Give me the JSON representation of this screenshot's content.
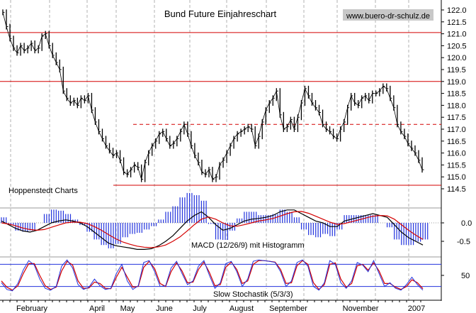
{
  "chart_data": {
    "type": "line",
    "title": "Bund Future Einjahreschart",
    "watermark": "www.buero-dr-schulz.de",
    "source_label": "Hoppenstedt Charts",
    "x_tick_labels": [
      "February",
      "April",
      "May",
      "June",
      "July",
      "August",
      "September",
      "November",
      "2007"
    ],
    "price_panel": {
      "y_tick_labels": [
        "122.0",
        "121.5",
        "121.0",
        "120.5",
        "120.0",
        "119.5",
        "119.0",
        "118.5",
        "118.0",
        "117.5",
        "117.0",
        "116.5",
        "116.0",
        "115.5",
        "115.0",
        "114.5"
      ],
      "ylim": [
        114.3,
        122.2
      ],
      "horizontal_lines": [
        {
          "value": 121.05,
          "style": "solid",
          "color": "#d40000"
        },
        {
          "value": 119.0,
          "style": "solid",
          "color": "#d40000"
        },
        {
          "value": 117.2,
          "style": "dashed",
          "color": "#d40000"
        },
        {
          "value": 114.65,
          "style": "solid",
          "color": "#d40000"
        }
      ],
      "series_close": [
        121.9,
        121.3,
        120.8,
        120.4,
        120.2,
        120.5,
        120.3,
        120.4,
        120.6,
        120.3,
        120.4,
        120.9,
        121.0,
        120.5,
        120.1,
        119.8,
        119.5,
        118.6,
        118.3,
        118.1,
        118.2,
        118.0,
        118.3,
        118.2,
        118.4,
        117.8,
        117.3,
        116.9,
        116.6,
        116.3,
        116.1,
        115.9,
        116.0,
        115.7,
        115.2,
        115.1,
        115.3,
        115.5,
        115.4,
        114.9,
        115.6,
        116.0,
        116.3,
        116.5,
        116.8,
        116.9,
        116.6,
        116.3,
        116.4,
        116.6,
        116.9,
        117.2,
        116.8,
        116.3,
        115.9,
        115.6,
        115.2,
        115.1,
        115.3,
        114.9,
        115.0,
        115.5,
        115.7,
        116.0,
        116.3,
        116.6,
        116.8,
        116.9,
        117.0,
        117.1,
        117.0,
        116.3,
        116.7,
        117.3,
        117.8,
        118.1,
        118.3,
        118.6,
        117.6,
        117.0,
        117.1,
        117.4,
        117.0,
        117.5,
        118.1,
        118.7,
        118.4,
        118.1,
        117.9,
        117.7,
        117.2,
        117.0,
        116.9,
        116.7,
        116.6,
        117.0,
        117.3,
        117.9,
        118.4,
        118.1,
        118.0,
        118.3,
        118.4,
        118.2,
        118.5,
        118.5,
        118.6,
        118.8,
        118.7,
        118.3,
        117.9,
        117.2,
        116.9,
        116.7,
        116.4,
        116.2,
        116.0,
        115.7,
        115.3
      ]
    },
    "macd_panel": {
      "label": "MACD (12/26/9) mit Histogramm",
      "y_tick_labels": [
        "0.0",
        "-0.5"
      ],
      "ylim": [
        -0.8,
        0.6
      ],
      "macd": [
        0.05,
        -0.05,
        -0.15,
        -0.22,
        -0.25,
        -0.2,
        -0.1,
        0.0,
        0.05,
        0.08,
        0.05,
        0.0,
        -0.1,
        -0.25,
        -0.4,
        -0.55,
        -0.62,
        -0.65,
        -0.68,
        -0.72,
        -0.72,
        -0.7,
        -0.62,
        -0.5,
        -0.35,
        -0.15,
        0.05,
        0.2,
        0.3,
        0.15,
        -0.05,
        -0.2,
        -0.15,
        -0.05,
        0.05,
        0.1,
        0.12,
        0.15,
        0.2,
        0.3,
        0.35,
        0.35,
        0.25,
        0.15,
        0.05,
        0.0,
        -0.1,
        -0.1,
        0.05,
        0.1,
        0.15,
        0.2,
        0.25,
        0.2,
        0.15,
        -0.05,
        -0.25,
        -0.4,
        -0.5,
        -0.6
      ],
      "signal": [
        0.0,
        -0.03,
        -0.08,
        -0.14,
        -0.18,
        -0.2,
        -0.18,
        -0.12,
        -0.06,
        0.0,
        0.02,
        0.02,
        -0.02,
        -0.1,
        -0.2,
        -0.32,
        -0.43,
        -0.52,
        -0.58,
        -0.63,
        -0.66,
        -0.67,
        -0.65,
        -0.6,
        -0.5,
        -0.38,
        -0.22,
        -0.05,
        0.1,
        0.16,
        0.1,
        0.0,
        -0.08,
        -0.09,
        -0.05,
        0.0,
        0.05,
        0.08,
        0.12,
        0.18,
        0.25,
        0.3,
        0.31,
        0.26,
        0.18,
        0.1,
        0.02,
        -0.04,
        -0.02,
        0.03,
        0.08,
        0.13,
        0.18,
        0.2,
        0.19,
        0.1,
        -0.05,
        -0.2,
        -0.33,
        -0.45
      ]
    },
    "stochastic_panel": {
      "label": "Slow Stochastik (5/3/3)",
      "y_tick_labels": [
        "50"
      ],
      "ylim": [
        0,
        100
      ],
      "reference_lines": [
        80,
        20
      ],
      "k": [
        30,
        12,
        8,
        28,
        65,
        90,
        78,
        40,
        15,
        10,
        20,
        75,
        92,
        70,
        25,
        12,
        18,
        40,
        22,
        12,
        15,
        55,
        80,
        35,
        12,
        22,
        85,
        90,
        60,
        20,
        22,
        70,
        88,
        55,
        25,
        35,
        75,
        90,
        50,
        15,
        30,
        82,
        88,
        60,
        20,
        40,
        88,
        92,
        90,
        88,
        85,
        60,
        20,
        35,
        85,
        92,
        75,
        20,
        10,
        30,
        90,
        80,
        30,
        15,
        35,
        85,
        78,
        60,
        90,
        55,
        20,
        30,
        15,
        10,
        25,
        45,
        25,
        10
      ],
      "d": [
        35,
        18,
        10,
        22,
        55,
        82,
        82,
        50,
        22,
        12,
        18,
        62,
        88,
        78,
        35,
        15,
        16,
        32,
        28,
        15,
        14,
        45,
        72,
        45,
        18,
        20,
        72,
        88,
        68,
        28,
        20,
        60,
        84,
        62,
        30,
        32,
        66,
        86,
        58,
        22,
        25,
        72,
        86,
        66,
        28,
        35,
        80,
        90,
        90,
        88,
        86,
        66,
        28,
        30,
        76,
        90,
        80,
        30,
        12,
        25,
        80,
        84,
        40,
        18,
        28,
        76,
        80,
        64,
        84,
        62,
        28,
        28,
        18,
        12,
        20,
        38,
        30,
        14
      ]
    }
  }
}
